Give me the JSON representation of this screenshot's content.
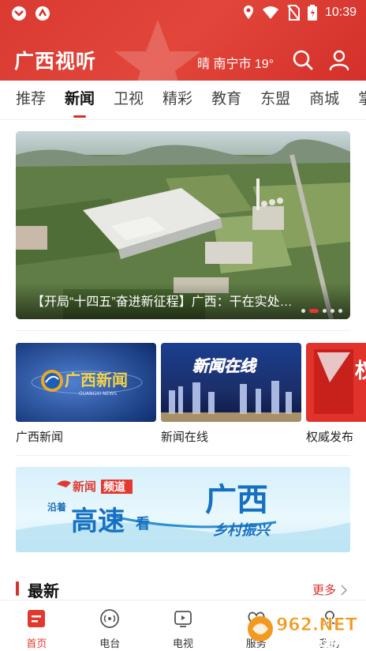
{
  "status_bar": {
    "time": "10:39"
  },
  "header": {
    "title": "广西视听",
    "weather": "晴 南宁市 19°",
    "icons": [
      "search-icon",
      "user-icon"
    ]
  },
  "tabs": [
    {
      "label": "推荐",
      "active": false
    },
    {
      "label": "新闻",
      "active": true
    },
    {
      "label": "卫视",
      "active": false
    },
    {
      "label": "精彩",
      "active": false
    },
    {
      "label": "教育",
      "active": false
    },
    {
      "label": "东盟",
      "active": false
    },
    {
      "label": "商城",
      "active": false
    },
    {
      "label": "掌",
      "active": false
    }
  ],
  "hero": {
    "caption": "【开局“十四五”奋进新征程】广西：干在实处…"
  },
  "channels": [
    {
      "label": "广西新闻",
      "logo_text": "广西新闻",
      "logo_sub": "GUANGXI NEWS"
    },
    {
      "label": "新闻在线",
      "logo_text": "新闻在线"
    },
    {
      "label": "权威发布",
      "logo_text": "权"
    }
  ],
  "banner": {
    "brand": "新闻",
    "brand2": "频道",
    "small_left": "沿着",
    "big1": "高速",
    "small_mid": "看",
    "big2": "广西",
    "slogan": "乡村振兴"
  },
  "latest": {
    "title": "最新",
    "more": "更多"
  },
  "bottom_nav": [
    {
      "label": "首页",
      "icon": "home-icon",
      "active": true
    },
    {
      "label": "电台",
      "icon": "radio-icon",
      "active": false
    },
    {
      "label": "电视",
      "icon": "tv-icon",
      "active": false
    },
    {
      "label": "服务",
      "icon": "service-icon",
      "active": false
    },
    {
      "label": "我的",
      "icon": "profile-icon",
      "active": false
    }
  ],
  "watermark": {
    "site": "962.NET",
    "sub": "乐游网"
  },
  "colors": {
    "brand_red": "#d9302a",
    "header_red": "#e2463a"
  }
}
